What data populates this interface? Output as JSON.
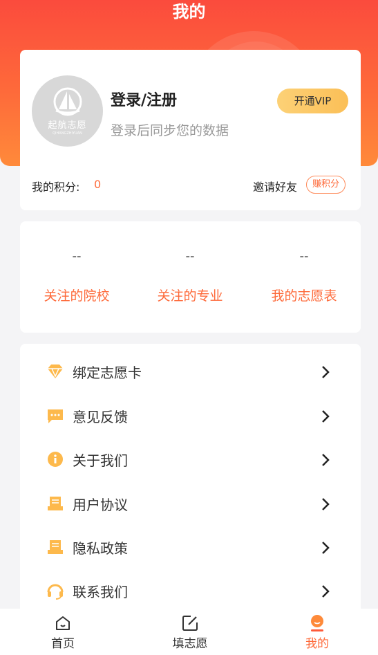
{
  "header": {
    "title": "我的"
  },
  "profile": {
    "avatar_logo_text": "起航志愿",
    "avatar_logo_sub": "QIHANGZHIYUAN",
    "login_title": "登录/注册",
    "login_subtitle": "登录后同步您的数据",
    "vip_label": "开通VIP",
    "points_label": "我的积分:",
    "points_value": "0",
    "invite_label": "邀请好友",
    "earn_label": "赚积分"
  },
  "stats": [
    {
      "value": "--",
      "label": "关注的院校"
    },
    {
      "value": "--",
      "label": "关注的专业"
    },
    {
      "value": "--",
      "label": "我的志愿表"
    }
  ],
  "menu": [
    {
      "label": "绑定志愿卡",
      "icon": "diamond-icon"
    },
    {
      "label": "意见反馈",
      "icon": "feedback-icon"
    },
    {
      "label": "关于我们",
      "icon": "info-icon"
    },
    {
      "label": "用户协议",
      "icon": "document-icon"
    },
    {
      "label": "隐私政策",
      "icon": "document-icon"
    },
    {
      "label": "联系我们",
      "icon": "headset-icon"
    }
  ],
  "tabs": [
    {
      "label": "首页",
      "icon": "home-icon",
      "active": false
    },
    {
      "label": "填志愿",
      "icon": "edit-icon",
      "active": false
    },
    {
      "label": "我的",
      "icon": "user-icon",
      "active": true
    }
  ],
  "colors": {
    "brand_orange": "#fe6a3a",
    "header_red": "#fb4b3d",
    "vip_gold": "#fcd176",
    "icon_orange": "#fdb94c"
  }
}
